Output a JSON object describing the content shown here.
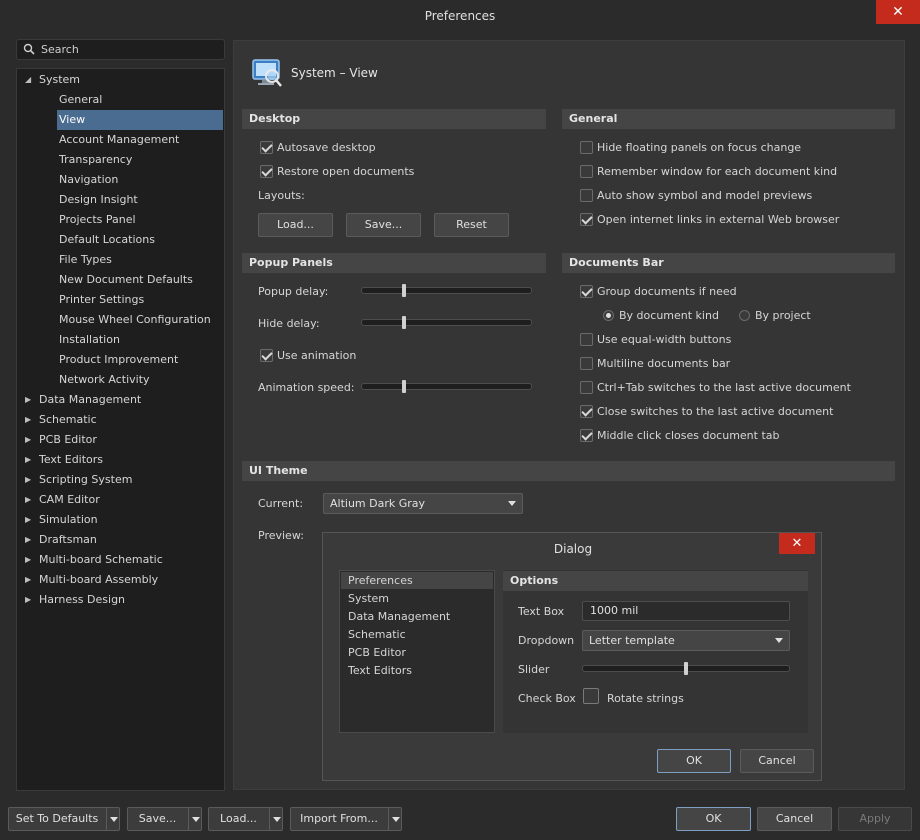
{
  "window": {
    "title": "Preferences",
    "close_glyph": "✕"
  },
  "search": {
    "placeholder": "Search"
  },
  "tree": {
    "system_label": "System",
    "system_children": [
      "General",
      "View",
      "Account Management",
      "Transparency",
      "Navigation",
      "Design Insight",
      "Projects Panel",
      "Default Locations",
      "File Types",
      "New Document Defaults",
      "Printer Settings",
      "Mouse Wheel Configuration",
      "Installation",
      "Product Improvement",
      "Network Activity"
    ],
    "selected": "View",
    "others": [
      "Data Management",
      "Schematic",
      "PCB Editor",
      "Text Editors",
      "Scripting System",
      "CAM Editor",
      "Simulation",
      "Draftsman",
      "Multi-board Schematic",
      "Multi-board Assembly",
      "Harness Design"
    ]
  },
  "page": {
    "title": "System – View"
  },
  "desktop": {
    "header": "Desktop",
    "autosave_label": "Autosave desktop",
    "autosave_checked": true,
    "restore_label": "Restore open documents",
    "restore_checked": true,
    "layouts_label": "Layouts:",
    "load_label": "Load...",
    "save_label": "Save...",
    "reset_label": "Reset"
  },
  "general": {
    "header": "General",
    "items": [
      {
        "label": "Hide floating panels on focus change",
        "checked": false
      },
      {
        "label": "Remember window for each document kind",
        "checked": false
      },
      {
        "label": "Auto show symbol and model previews",
        "checked": false
      },
      {
        "label": "Open internet links in external Web browser",
        "checked": true
      }
    ]
  },
  "popup": {
    "header": "Popup Panels",
    "popup_delay_label": "Popup delay:",
    "popup_delay_value": 0.25,
    "hide_delay_label": "Hide delay:",
    "hide_delay_value": 0.25,
    "use_animation_label": "Use animation",
    "use_animation_checked": true,
    "animation_speed_label": "Animation speed:",
    "animation_speed_value": 0.25
  },
  "documents_bar": {
    "header": "Documents Bar",
    "group_label": "Group documents if need",
    "group_checked": true,
    "by_kind_label": "By document kind",
    "by_kind_selected": true,
    "by_project_label": "By project",
    "items": [
      {
        "label": "Use equal-width buttons",
        "checked": false
      },
      {
        "label": "Multiline documents bar",
        "checked": false
      },
      {
        "label": "Ctrl+Tab switches to the last active document",
        "checked": false
      },
      {
        "label": "Close switches to the last active document",
        "checked": true
      },
      {
        "label": "Middle click closes document tab",
        "checked": true
      }
    ]
  },
  "ui_theme": {
    "header": "UI Theme",
    "current_label": "Current:",
    "current_value": "Altium Dark Gray",
    "preview_label": "Preview:"
  },
  "preview_dialog": {
    "title": "Dialog",
    "list": [
      "Preferences",
      "System",
      "Data Management",
      "Schematic",
      "PCB Editor",
      "Text Editors"
    ],
    "options_header": "Options",
    "textbox_label": "Text Box",
    "textbox_value": "1000 mil",
    "dropdown_label": "Dropdown",
    "dropdown_value": "Letter template",
    "slider_label": "Slider",
    "slider_value": 0.5,
    "checkbox_label": "Check Box",
    "checkbox_text": "Rotate strings",
    "ok_label": "OK",
    "cancel_label": "Cancel"
  },
  "footer": {
    "set_defaults": "Set To Defaults",
    "save": "Save...",
    "load": "Load...",
    "import_from": "Import From...",
    "ok": "OK",
    "cancel": "Cancel",
    "apply": "Apply"
  },
  "colors": {
    "accent_selection": "#4a6c91",
    "close_red": "#c42b1c",
    "panel_bg": "#353535",
    "tree_bg": "#1e1e1e"
  }
}
